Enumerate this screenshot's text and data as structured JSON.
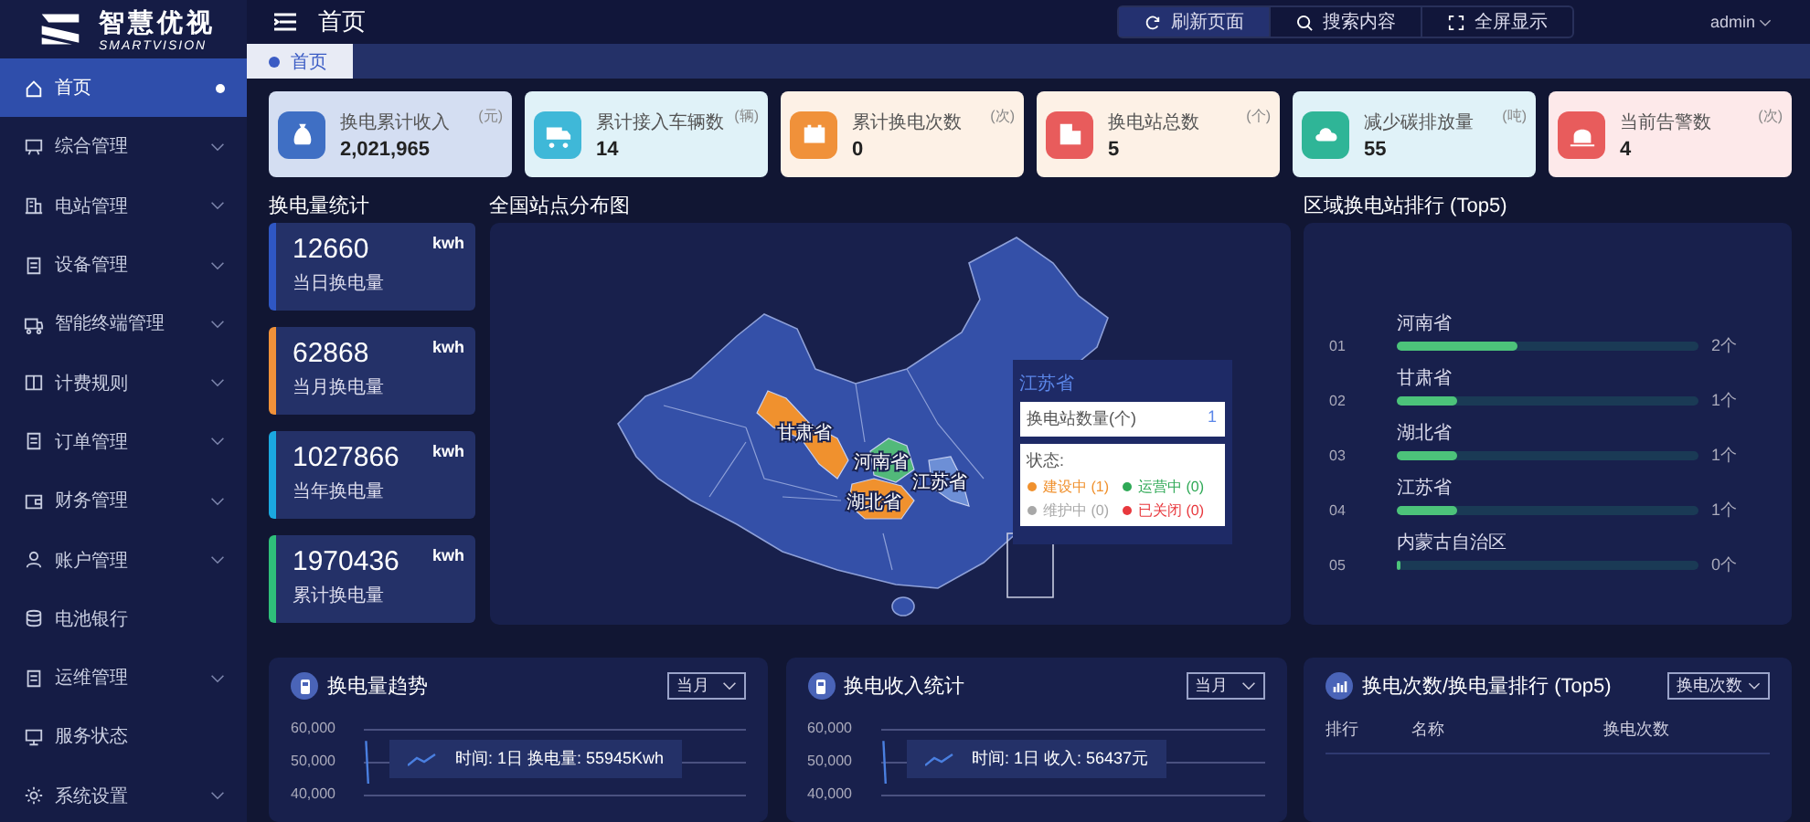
{
  "logo": {
    "name": "智慧优视",
    "subtitle": "SMARTVISION"
  },
  "sidebar": {
    "items": [
      {
        "label": "首页",
        "kind": "link",
        "selected": true
      },
      {
        "label": "综合管理",
        "kind": "group",
        "selected": false
      },
      {
        "label": "电站管理",
        "kind": "group",
        "selected": false
      },
      {
        "label": "设备管理",
        "kind": "group",
        "selected": false
      },
      {
        "label": "智能终端管理",
        "kind": "group",
        "selected": false
      },
      {
        "label": "计费规则",
        "kind": "group",
        "selected": false
      },
      {
        "label": "订单管理",
        "kind": "group",
        "selected": false
      },
      {
        "label": "财务管理",
        "kind": "group",
        "selected": false
      },
      {
        "label": "账户管理",
        "kind": "group",
        "selected": false
      },
      {
        "label": "电池银行",
        "kind": "link",
        "selected": false
      },
      {
        "label": "运维管理",
        "kind": "group",
        "selected": false
      },
      {
        "label": "服务状态",
        "kind": "link",
        "selected": false
      },
      {
        "label": "系统设置",
        "kind": "group",
        "selected": false
      }
    ]
  },
  "header": {
    "title": "首页",
    "actions": [
      {
        "label": "刷新页面",
        "selected": true
      },
      {
        "label": "搜索内容",
        "selected": false
      },
      {
        "label": "全屏显示",
        "selected": false
      }
    ],
    "user": "admin"
  },
  "tabs": [
    {
      "label": "首页",
      "selected": true
    }
  ],
  "stats": [
    {
      "label": "换电累计收入",
      "unit": "(元)",
      "value": "2,021,965",
      "color": "#3f6fc4"
    },
    {
      "label": "累计接入车辆数",
      "unit": "(辆)",
      "value": "14",
      "color": "#3fb8d8"
    },
    {
      "label": "累计换电次数",
      "unit": "(次)",
      "value": "0",
      "color": "#f0913a"
    },
    {
      "label": "换电站总数",
      "unit": "(个)",
      "value": "5",
      "color": "#e85c5c"
    },
    {
      "label": "减少碳排放量",
      "unit": "(吨)",
      "value": "55",
      "color": "#2fb597"
    },
    {
      "label": "当前告警数",
      "unit": "(次)",
      "value": "4",
      "color": "#e85c5c"
    }
  ],
  "energy": {
    "title": "换电量统计",
    "cards": [
      {
        "value": "12660",
        "unit": "kwh",
        "label": "当日换电量",
        "color": "#2f57c4"
      },
      {
        "value": "62868",
        "unit": "kwh",
        "label": "当月换电量",
        "color": "#f0913a"
      },
      {
        "value": "1027866",
        "unit": "kwh",
        "label": "当年换电量",
        "color": "#1ba8e0"
      },
      {
        "value": "1970436",
        "unit": "kwh",
        "label": "累计换电量",
        "color": "#2fbf7a"
      }
    ]
  },
  "map": {
    "title": "全国站点分布图",
    "provinces": [
      {
        "label": "甘肃省",
        "color": "#f0912e"
      },
      {
        "label": "河南省",
        "color": "#52b97a"
      },
      {
        "label": "湖北省",
        "color": "#f0912e"
      },
      {
        "label": "江苏省",
        "color": "#6d8fd6"
      }
    ],
    "tooltip": {
      "title": "江苏省",
      "metric": "换电站数量(个)",
      "metric_value": "1",
      "status_label": "状态:",
      "statuses": [
        {
          "label": "建设中 (1)",
          "color": "#f0912e"
        },
        {
          "label": "运营中 (0)",
          "color": "#2fa956"
        },
        {
          "label": "维护中 (0)",
          "color": "#a8a8a8"
        },
        {
          "label": "已关闭 (0)",
          "color": "#e8383d"
        }
      ]
    }
  },
  "ranking": {
    "title": "区域换电站排行 (Top5)",
    "rows": [
      {
        "rank": "01",
        "name": "河南省",
        "level": 0.4,
        "count": "2个"
      },
      {
        "rank": "02",
        "name": "甘肃省",
        "level": 0.2,
        "count": "1个"
      },
      {
        "rank": "03",
        "name": "湖北省",
        "level": 0.2,
        "count": "1个"
      },
      {
        "rank": "04",
        "name": "江苏省",
        "level": 0.2,
        "count": "1个"
      },
      {
        "rank": "05",
        "name": "内蒙古自治区",
        "level": 0,
        "count": "0个"
      }
    ]
  },
  "trend_panels": [
    {
      "title": "换电量趋势",
      "select": "当月",
      "yticks": [
        "60,000",
        "50,000",
        "40,000"
      ],
      "tooltip": "时间: 1日 换电量: 55945Kwh"
    },
    {
      "title": "换电收入统计",
      "select": "当月",
      "yticks": [
        "60,000",
        "50,000",
        "40,000"
      ],
      "tooltip": "时间: 1日 收入: 56437元"
    }
  ],
  "top_panel": {
    "title": "换电次数/换电量排行 (Top5)",
    "select": "换电次数",
    "columns": [
      "排行",
      "名称",
      "换电次数"
    ]
  }
}
